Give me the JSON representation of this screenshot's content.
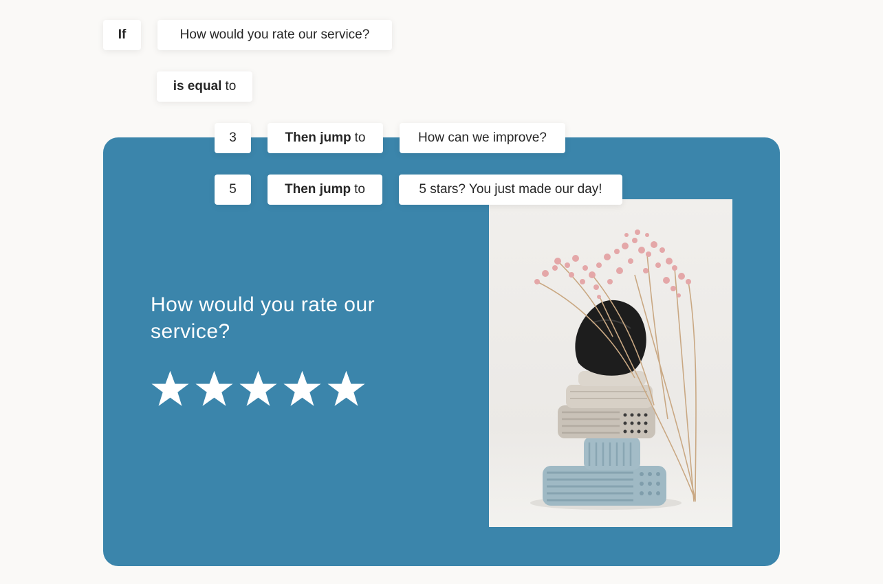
{
  "logic": {
    "if_label": "If",
    "question_ref": "How would you rate our service?",
    "operator_bold": "is equal",
    "operator_rest": "to",
    "rules": [
      {
        "value": "3",
        "action_bold": "Then jump",
        "action_rest": "to",
        "target": "How can we improve?"
      },
      {
        "value": "5",
        "action_bold": "Then jump",
        "action_rest": "to",
        "target": "5 stars? You just made our day!"
      }
    ]
  },
  "question_card": {
    "title": "How would you rate our service?",
    "rating_max": 5,
    "star_icon": "star-icon",
    "background_color": "#3b85ab",
    "star_color": "#ffffff"
  },
  "image": {
    "subject": "stacked clay blocks with dried pink flowers"
  }
}
